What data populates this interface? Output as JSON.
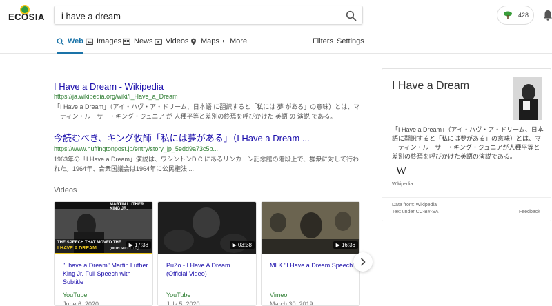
{
  "header": {
    "logo_text": "ECOSIA",
    "search_value": "i have a dream",
    "tree_count": "428"
  },
  "tabs": [
    {
      "label": "Web",
      "icon": "search-icon",
      "active": true
    },
    {
      "label": "Images",
      "icon": "image-icon",
      "active": false
    },
    {
      "label": "News",
      "icon": "news-icon",
      "active": false
    },
    {
      "label": "Videos",
      "icon": "video-icon",
      "active": false
    },
    {
      "label": "Maps",
      "icon": "map-pin-icon",
      "active": false
    },
    {
      "label": "More",
      "icon": "more-icon",
      "active": false
    }
  ],
  "right_links": {
    "filters": "Filters",
    "settings": "Settings"
  },
  "results": [
    {
      "title": "I Have a Dream - Wikipedia",
      "url": "https://ja.wikipedia.org/wiki/I_Have_a_Dream",
      "snippet": "「I Have a Dream」（アイ・ハヴ・ア・ドリーム、日本語 に翻訳すると「私には 夢 がある」の意味）とは、マーティン・ルーサー・キング・ジュニア が 人種平等と差別の終焉を呼びかけた 英語 の 演説 である。"
    },
    {
      "title": "今読むべき、キング牧師「私には夢がある」（I Have a Dream ...",
      "url": "https://www.huffingtonpost.jp/entry/story_jp_5edd9a73c5b...",
      "snippet": "1963年の「I Have a Dream」演説は、ワシントンD.C.にあるリンカーン記念館の階段上で、群衆に対して行われた。1964年、合衆国議会は1964年に公民権法 ..."
    }
  ],
  "videos": {
    "heading": "Videos",
    "items": [
      {
        "duration": "▶ 17:38",
        "title": "\"I have a Dream\" Martin Luther King Jr. Full Speech with Subtitle",
        "source": "YouTube",
        "date": "June 6, 2020",
        "thumb_text": "MARTIN LUTHER KING JR.",
        "thumb_text2": "THE SPEECH THAT MOVED THE",
        "thumb_text3": "I HAVE A DREAM",
        "thumb_text4": "(WITH SUBTITLE)"
      },
      {
        "duration": "▶ 03:38",
        "title": "PuZo - I Have A Dream (Official Video)",
        "source": "YouTube",
        "date": "July 5, 2020"
      },
      {
        "duration": "▶ 16:36",
        "title": "MLK \"I Have a Dream Speech\"",
        "source": "Vimeo",
        "date": "March 30, 2019"
      }
    ]
  },
  "panel": {
    "title": "I Have a Dream",
    "description": "「I Have a Dream」（アイ・ハヴ・ア・ドリーム、日本語に翻訳すると「私には夢がある」の意味）とは、マーティン・ルーサー・キング・ジュニアが人種平等と差別の終焉を呼びかけた英語の演説である。",
    "wiki_logo": "W",
    "wiki_label": "Wikipedia",
    "data_from": "Data from: Wikipedia",
    "license": "Text under CC-BY-SA",
    "feedback": "Feedback"
  },
  "colors": {
    "accent": "#1a73a8",
    "link": "#1a0dab",
    "url": "#2e7d32"
  }
}
